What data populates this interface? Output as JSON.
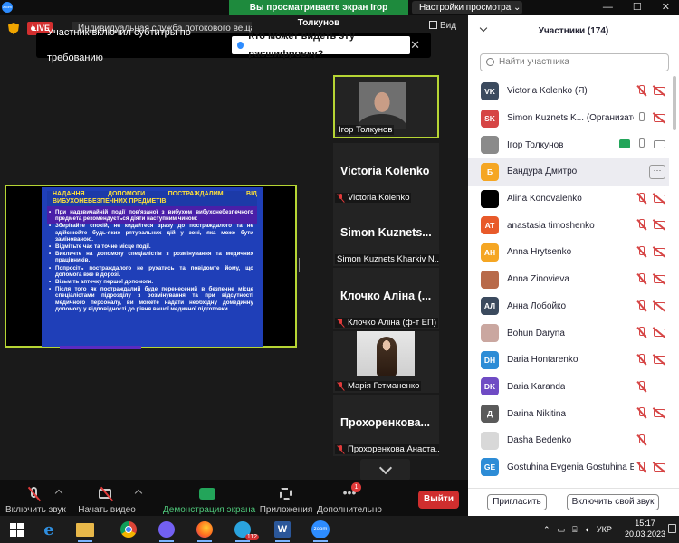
{
  "topbar": {
    "zoom_badge": "zoom",
    "share_banner": "Вы просматриваете экран Ігор Толкунов",
    "view_options": "Настройки просмотра ⌄",
    "window_controls": [
      "—",
      "☐",
      "✕"
    ]
  },
  "meeting": {
    "live_label": "LIVE",
    "title": "Индивидуальная служба потокового вещания",
    "view_label": "Вид"
  },
  "caption_toast": {
    "message": "Участник включил субтитры по требованию",
    "link": "Кто может видеть эту расшифровку?",
    "close": "✕"
  },
  "slide": {
    "heading_line1": "НАДАННЯ ДОПОМОГИ ПОСТРАЖДАЛИМ ВІД",
    "heading_line2": "ВИБУХОНЕБЕЗПЕЧНИХ ПРЕДМЕТІВ",
    "bullets": [
      "При надзвичайній події пов'язаної з вибухом вибухонебезпечного предмета рекомендується діяти наступним чином:",
      "Зберігайте спокій, не кидайтеся зразу до постраждалого та не здійснюйте будь-яких рятувальних дій у зоні, яка може бути замінованою.",
      "Відмітьте час та точне місце події.",
      "Викличте на допомогу спеціалістів з розмінування та медичних працівників.",
      "Попросіть постраждалого не рухатись та повідомте йому, що допомога вже в дорозі.",
      "Візьміть аптечку першої допомоги.",
      "Після того як постраждалий буде перенесений в безпечне місце спеціалістами підрозділу з розмінування та при відсутності медичного персоналу, ви можете надати необхідну домедичну допомогу у відповідності до рівня вашої медичної підготовки."
    ]
  },
  "tiles": [
    {
      "name": "",
      "label": "Ігор Толкунов"
    },
    {
      "name": "Victoria Kolenko",
      "label": "Victoria Kolenko"
    },
    {
      "name": "Simon Kuznets...",
      "label": "Simon Kuznets Kharkiv N..."
    },
    {
      "name": "Клочко Аліна (...",
      "label": "Клочко Аліна (ф-т ЕП)"
    },
    {
      "name": "",
      "label": "Марія Гетманенко"
    },
    {
      "name": "Прохоренкова...",
      "label": "Прохоренкова Анаста..."
    }
  ],
  "toolbar": {
    "mute": "Включить звук",
    "video": "Начать видео",
    "share": "Демонстрация экрана",
    "apps": "Приложения",
    "more": "Дополнительно",
    "more_badge": "1",
    "leave": "Выйти"
  },
  "participants": {
    "title": "Участники (174)",
    "search_placeholder": "Найти участника",
    "invite": "Пригласить",
    "unmute_self": "Включить свой звук",
    "rows": [
      {
        "initials": "VK",
        "color": "#3b4a5e",
        "name": "Victoria Kolenko",
        "role": "(Я)",
        "mic": "off",
        "cam": "off"
      },
      {
        "initials": "SK",
        "color": "#d64545",
        "name": "Simon Kuznets K...",
        "role": "(Организатор)",
        "mic": "on",
        "cam": "off"
      },
      {
        "initials": "",
        "color": "#8a8a8a",
        "name": "Ігор Толкунов",
        "role": "",
        "mic": "on",
        "cam": "on",
        "share": true
      },
      {
        "initials": "Б",
        "color": "#f5a623",
        "name": "Бандура Дмитро",
        "role": "",
        "mic": "none",
        "cam": "none",
        "more": "···"
      },
      {
        "initials": "",
        "color": "#000000",
        "name": "Alina Konovalenko",
        "role": "",
        "mic": "off",
        "cam": "off"
      },
      {
        "initials": "AT",
        "color": "#e85a2a",
        "name": "anastasia timoshenko",
        "role": "",
        "mic": "off",
        "cam": "off"
      },
      {
        "initials": "AH",
        "color": "#f5a623",
        "name": "Anna Hrytsenko",
        "role": "",
        "mic": "off",
        "cam": "off"
      },
      {
        "initials": "",
        "color": "#b86a4a",
        "name": "Anna Zinovieva",
        "role": "",
        "mic": "off",
        "cam": "off"
      },
      {
        "initials": "АЛ",
        "color": "#3b4a5e",
        "name": "Анна Лобойко",
        "role": "",
        "mic": "off",
        "cam": "off"
      },
      {
        "initials": "",
        "color": "#caa7a0",
        "name": "Bohun Daryna",
        "role": "",
        "mic": "off",
        "cam": "off"
      },
      {
        "initials": "DH",
        "color": "#2d8cd6",
        "name": "Daria Hontarenko",
        "role": "",
        "mic": "off",
        "cam": "off"
      },
      {
        "initials": "DK",
        "color": "#6f4bc4",
        "name": "Daria Karanda",
        "role": "",
        "mic": "off",
        "cam": "none"
      },
      {
        "initials": "Д",
        "color": "#5a5a5a",
        "name": "Darina Nikitina",
        "role": "",
        "mic": "off",
        "cam": "off"
      },
      {
        "initials": "",
        "color": "#d8d8d8",
        "name": "Dasha Bedenko",
        "role": "",
        "mic": "off",
        "cam": "none"
      },
      {
        "initials": "GE",
        "color": "#2d8cd6",
        "name": "Gostuhina Evgenia Gostuhina Ev...",
        "role": "",
        "mic": "off",
        "cam": "off"
      }
    ]
  },
  "taskbar": {
    "telegram_badge": "112",
    "zoom_label": "zoom",
    "lang": "УКР",
    "time": "15:17",
    "date": "20.03.2023"
  }
}
